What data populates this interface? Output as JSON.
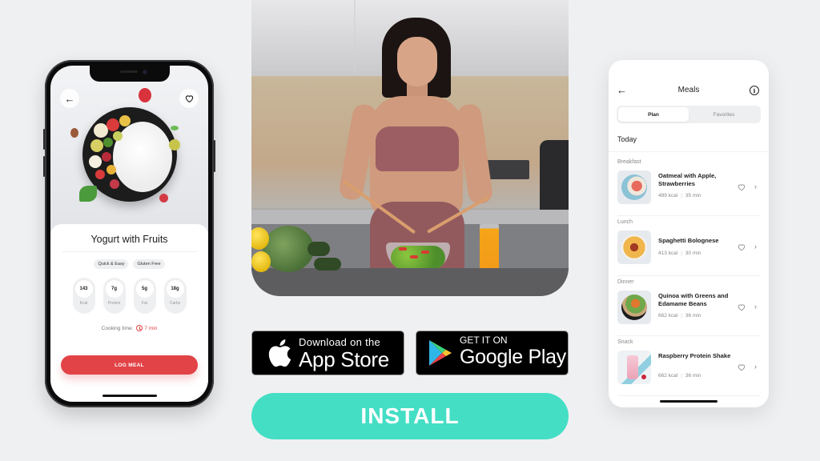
{
  "left_phone": {
    "back_icon": "arrow-left-icon",
    "favorite_icon": "heart-icon",
    "recipe_title": "Yogurt with Fruits",
    "tags": [
      "Quick & Easy",
      "Gluten Free"
    ],
    "macros": [
      {
        "value": "143",
        "label": "Kcal"
      },
      {
        "value": "7g",
        "label": "Protein"
      },
      {
        "value": "5g",
        "label": "Fat"
      },
      {
        "value": "18g",
        "label": "Carbs"
      }
    ],
    "cooking_time_label": "Cooking time:",
    "cooking_time_value": "7 min",
    "log_button": "LOG MEAL",
    "accent_color": "#e14347"
  },
  "store_buttons": {
    "appstore_small": "Download on the",
    "appstore_big": "App Store",
    "googleplay_small": "GET IT ON",
    "googleplay_big": "Google Play"
  },
  "install_button": {
    "label": "INSTALL",
    "color": "#44dec5"
  },
  "right_phone": {
    "back_icon": "arrow-left-icon",
    "title": "Meals",
    "info_icon": "info-icon",
    "info_glyph": "i",
    "segments": [
      {
        "label": "Plan",
        "active": true
      },
      {
        "label": "Favorites",
        "active": false
      }
    ],
    "day_label": "Today",
    "sections": [
      {
        "category": "Breakfast",
        "name": "Oatmeal with Apple, Strawberries",
        "kcal": "489 kcal",
        "time": "35 min"
      },
      {
        "category": "Lunch",
        "name": "Spaghetti Bolognese",
        "kcal": "413 kcal",
        "time": "30 min"
      },
      {
        "category": "Dinner",
        "name": "Quinoa with Greens and Edamame Beans",
        "kcal": "662 kcal",
        "time": "36 min"
      },
      {
        "category": "Snack",
        "name": "Raspberry Protein Shake",
        "kcal": "662 kcal",
        "time": "36 min"
      }
    ]
  }
}
